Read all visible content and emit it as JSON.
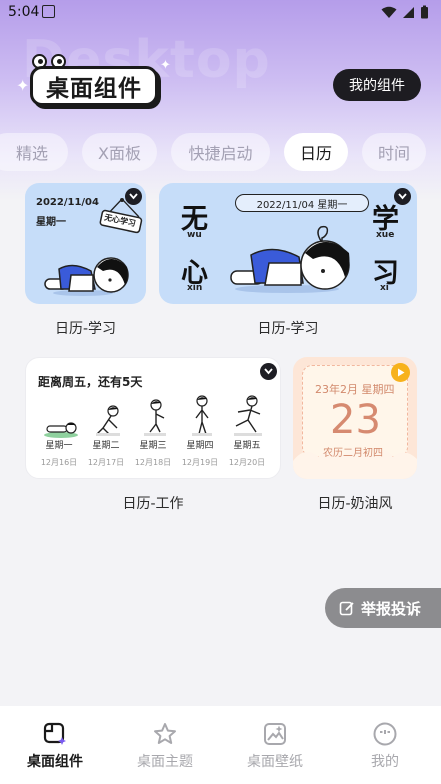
{
  "status_bar": {
    "time": "5:04"
  },
  "header": {
    "watermark": "Desktop",
    "logo_text": "桌面组件",
    "my_widgets_button": "我的组件"
  },
  "tabs": [
    {
      "label": "精选",
      "active": false
    },
    {
      "label": "X面板",
      "active": false
    },
    {
      "label": "快捷启动",
      "active": false
    },
    {
      "label": "日历",
      "active": true
    },
    {
      "label": "时间",
      "active": false
    }
  ],
  "widgets": {
    "study_small": {
      "date": "2022/11/04",
      "weekday": "星期一",
      "sign_text": "无心学习",
      "caption": "日历-学习"
    },
    "study_wide": {
      "date_line": "2022/11/04 星期一",
      "chars": [
        {
          "char": "无",
          "pinyin": "wu"
        },
        {
          "char": "心",
          "pinyin": "xin"
        },
        {
          "char": "学",
          "pinyin": "xue"
        },
        {
          "char": "习",
          "pinyin": "xi"
        }
      ],
      "caption": "日历-学习"
    },
    "work": {
      "headline": "距离周五，还有5天",
      "days": [
        {
          "name": "星期一",
          "date": "12月16日"
        },
        {
          "name": "星期二",
          "date": "12月17日"
        },
        {
          "name": "星期三",
          "date": "12月18日"
        },
        {
          "name": "星期四",
          "date": "12月19日"
        },
        {
          "name": "星期五",
          "date": "12月20日"
        }
      ],
      "caption": "日历-工作"
    },
    "cream": {
      "month_line": "23年2月 星期四",
      "day": "23",
      "lunar": "农历二月初四",
      "caption": "日历-奶油风"
    }
  },
  "report_button": "举报投诉",
  "bottom_nav": [
    {
      "label": "桌面组件",
      "icon": "widget-icon",
      "active": true
    },
    {
      "label": "桌面主题",
      "icon": "star-icon",
      "active": false
    },
    {
      "label": "桌面壁纸",
      "icon": "wallpaper-icon",
      "active": false
    },
    {
      "label": "我的",
      "icon": "face-icon",
      "active": false
    }
  ],
  "colors": {
    "accent_purple": "#b59dea",
    "card_blue": "#c6ddf9",
    "card_cream": "#fde6d7",
    "play_orange": "#f7b21c"
  }
}
